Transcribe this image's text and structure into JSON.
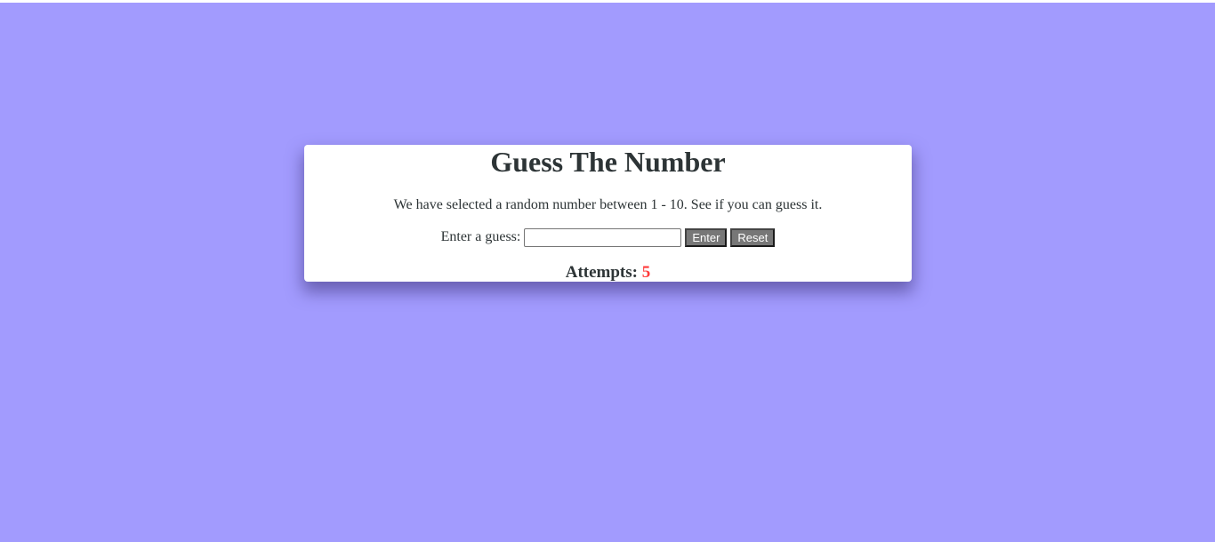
{
  "game": {
    "title": "Guess The Number",
    "description": "We have selected a random number between 1 - 10. See if you can guess it.",
    "guess_label": "Enter a guess:",
    "guess_value": "",
    "enter_button": "Enter",
    "reset_button": "Reset",
    "attempts_label": "Attempts:",
    "attempts_count": "5"
  },
  "colors": {
    "background": "#a29bfe",
    "card": "#ffffff",
    "text": "#2d3436",
    "button": "#777777",
    "attempts_count": "#ff3b3b"
  }
}
